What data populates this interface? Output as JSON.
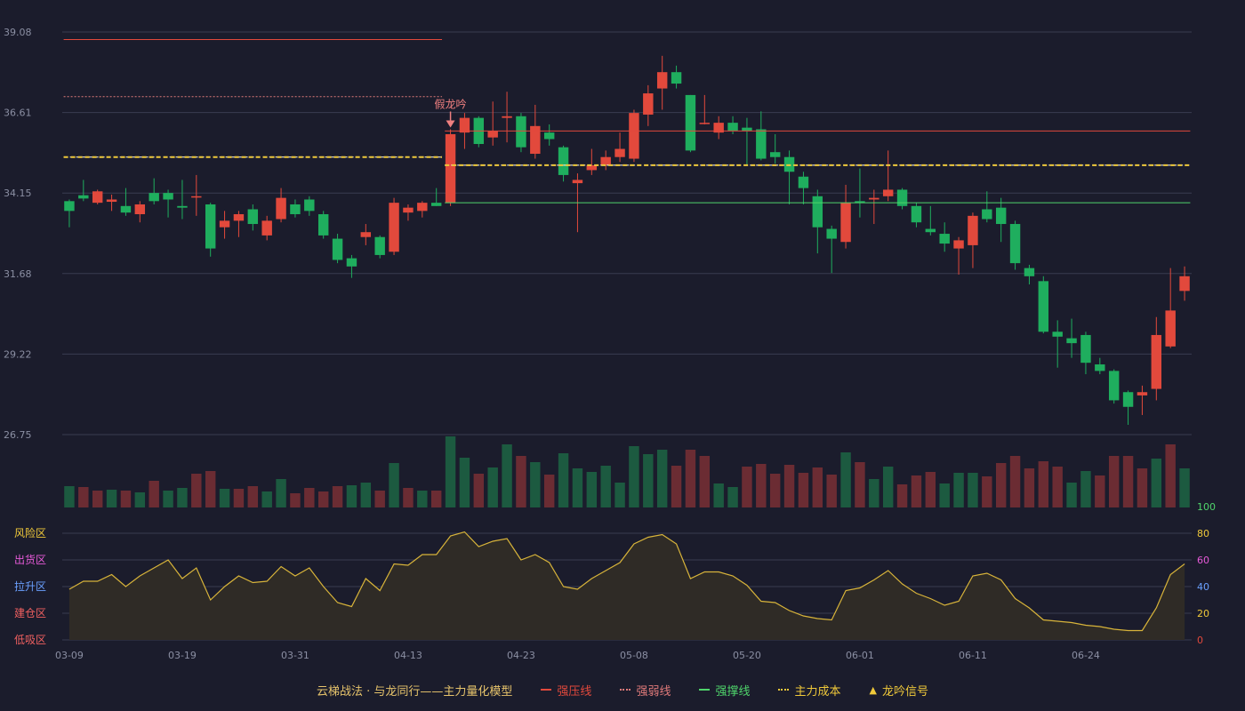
{
  "colors": {
    "background": "#1b1c2c",
    "grid": "#3a3c50",
    "axis_text": "#8b8fa3",
    "up": "#e2493c",
    "down": "#1fae5e",
    "vol_up": "#6b2c33",
    "vol_down": "#1c5a40",
    "pressure": "#e2493c",
    "weak": "#e07a7a",
    "support": "#4fd46b",
    "cost": "#f0c93a",
    "oscillator": "#d8b43a",
    "osc_fill": "#2f2b26"
  },
  "legend": {
    "title": "云梯战法 · 与龙同行——主力量化模型",
    "items": [
      {
        "label": "强压线",
        "color": "#e2493c",
        "style": "solid"
      },
      {
        "label": "强弱线",
        "color": "#e07a7a",
        "style": "dotted"
      },
      {
        "label": "强撑线",
        "color": "#4fd46b",
        "style": "solid"
      },
      {
        "label": "主力成本",
        "color": "#f0c93a",
        "style": "dotted"
      },
      {
        "label": "龙吟信号",
        "color": "#f0c93a",
        "style": "triangle"
      }
    ]
  },
  "chart_data": {
    "type": "candlestick",
    "price_axis": {
      "ticks": [
        "39.08",
        "36.61",
        "34.15",
        "31.68",
        "29.22",
        "26.75"
      ],
      "range": [
        26.75,
        39.08
      ]
    },
    "x_tick_labels": [
      {
        "index": 0,
        "label": "03-09"
      },
      {
        "index": 8,
        "label": "03-19"
      },
      {
        "index": 16,
        "label": "03-31"
      },
      {
        "index": 24,
        "label": "04-13"
      },
      {
        "index": 32,
        "label": "04-23"
      },
      {
        "index": 40,
        "label": "05-08"
      },
      {
        "index": 48,
        "label": "05-20"
      },
      {
        "index": 56,
        "label": "06-01"
      },
      {
        "index": 64,
        "label": "06-11"
      },
      {
        "index": 72,
        "label": "06-24"
      }
    ],
    "candles": [
      [
        33.9,
        33.6,
        33.95,
        33.1
      ],
      [
        34.08,
        33.98,
        34.55,
        33.9
      ],
      [
        33.85,
        34.2,
        34.25,
        33.8
      ],
      [
        33.88,
        33.95,
        34.1,
        33.6
      ],
      [
        33.75,
        33.55,
        34.3,
        33.45
      ],
      [
        33.5,
        33.8,
        33.9,
        33.25
      ],
      [
        34.15,
        33.9,
        34.6,
        33.8
      ],
      [
        34.15,
        33.95,
        34.25,
        33.4
      ],
      [
        33.75,
        33.7,
        34.55,
        33.35
      ],
      [
        34.02,
        34.05,
        34.7,
        33.45
      ],
      [
        33.8,
        32.45,
        33.85,
        32.2
      ],
      [
        33.1,
        33.3,
        33.6,
        32.75
      ],
      [
        33.3,
        33.5,
        33.6,
        32.8
      ],
      [
        33.65,
        33.2,
        33.8,
        33.0
      ],
      [
        32.85,
        33.3,
        33.45,
        32.7
      ],
      [
        33.35,
        34.0,
        34.3,
        33.25
      ],
      [
        33.8,
        33.5,
        33.95,
        33.4
      ],
      [
        33.95,
        33.6,
        34.05,
        33.45
      ],
      [
        33.5,
        32.85,
        33.6,
        32.75
      ],
      [
        32.75,
        32.1,
        32.9,
        32.0
      ],
      [
        32.15,
        31.9,
        32.25,
        31.55
      ],
      [
        32.8,
        32.95,
        33.2,
        32.55
      ],
      [
        32.8,
        32.25,
        32.85,
        32.15
      ],
      [
        32.35,
        33.85,
        34.0,
        32.25
      ],
      [
        33.55,
        33.7,
        33.8,
        33.3
      ],
      [
        33.6,
        33.85,
        33.9,
        33.4
      ],
      [
        33.85,
        33.75,
        34.3,
        33.75
      ],
      [
        33.85,
        35.95,
        36.1,
        33.75
      ],
      [
        36.0,
        36.45,
        36.6,
        35.5
      ],
      [
        36.45,
        35.65,
        36.5,
        35.55
      ],
      [
        35.85,
        36.05,
        36.95,
        35.6
      ],
      [
        36.45,
        36.5,
        37.25,
        35.7
      ],
      [
        36.5,
        35.55,
        36.6,
        35.4
      ],
      [
        35.35,
        36.2,
        36.85,
        35.2
      ],
      [
        36.0,
        35.8,
        36.25,
        35.6
      ],
      [
        35.55,
        34.7,
        35.6,
        34.5
      ],
      [
        34.45,
        34.55,
        34.75,
        32.95
      ],
      [
        34.85,
        35.0,
        35.5,
        34.7
      ],
      [
        35.0,
        35.25,
        35.45,
        34.85
      ],
      [
        35.25,
        35.5,
        36.0,
        35.1
      ],
      [
        35.2,
        36.6,
        36.7,
        35.1
      ],
      [
        36.55,
        37.2,
        37.45,
        36.2
      ],
      [
        37.35,
        37.85,
        38.35,
        36.7
      ],
      [
        37.85,
        37.5,
        38.05,
        37.35
      ],
      [
        37.15,
        35.45,
        37.15,
        35.4
      ],
      [
        36.3,
        36.3,
        37.15,
        36.25
      ],
      [
        36.0,
        36.3,
        36.5,
        35.8
      ],
      [
        36.3,
        36.05,
        36.5,
        35.95
      ],
      [
        36.15,
        36.05,
        36.45,
        35.0
      ],
      [
        36.1,
        35.2,
        36.65,
        35.15
      ],
      [
        35.4,
        35.25,
        35.95,
        35.05
      ],
      [
        35.25,
        34.8,
        35.45,
        33.8
      ],
      [
        34.65,
        34.3,
        34.8,
        33.8
      ],
      [
        34.05,
        33.1,
        34.25,
        32.3
      ],
      [
        33.05,
        32.75,
        33.15,
        31.7
      ],
      [
        32.65,
        33.85,
        34.4,
        32.45
      ],
      [
        33.9,
        33.85,
        34.9,
        33.4
      ],
      [
        33.95,
        34.0,
        34.25,
        33.2
      ],
      [
        34.05,
        34.25,
        35.45,
        33.9
      ],
      [
        34.25,
        33.75,
        34.3,
        33.65
      ],
      [
        33.75,
        33.25,
        33.85,
        33.1
      ],
      [
        33.05,
        32.95,
        33.75,
        32.85
      ],
      [
        32.9,
        32.6,
        33.25,
        32.35
      ],
      [
        32.45,
        32.7,
        32.8,
        31.65
      ],
      [
        32.55,
        33.45,
        33.55,
        31.85
      ],
      [
        33.65,
        33.35,
        34.2,
        33.25
      ],
      [
        33.7,
        33.2,
        34.0,
        32.65
      ],
      [
        33.2,
        32.0,
        33.3,
        31.8
      ],
      [
        31.85,
        31.6,
        31.95,
        31.35
      ],
      [
        31.45,
        29.9,
        31.6,
        29.85
      ],
      [
        29.9,
        29.75,
        30.25,
        28.8
      ],
      [
        29.7,
        29.55,
        30.3,
        29.1
      ],
      [
        29.8,
        28.95,
        29.9,
        28.6
      ],
      [
        28.9,
        28.7,
        29.1,
        28.6
      ],
      [
        28.7,
        27.8,
        28.75,
        27.7
      ],
      [
        28.05,
        27.6,
        28.1,
        27.05
      ],
      [
        27.95,
        28.05,
        28.25,
        27.35
      ],
      [
        28.15,
        29.8,
        30.35,
        27.8
      ],
      [
        29.45,
        30.55,
        31.85,
        29.4
      ],
      [
        31.15,
        31.6,
        31.9,
        30.85
      ]
    ],
    "volume_direction": [
      "down",
      "up",
      "up",
      "down",
      "up",
      "down",
      "up",
      "down",
      "down",
      "up",
      "up",
      "down",
      "up",
      "up",
      "down",
      "down",
      "up",
      "up",
      "up",
      "up",
      "down",
      "down",
      "up",
      "down",
      "up",
      "down",
      "up",
      "down",
      "down",
      "up",
      "down",
      "down",
      "up",
      "down",
      "up",
      "down",
      "down",
      "down",
      "down",
      "down",
      "down",
      "down",
      "down",
      "up",
      "up",
      "up",
      "down",
      "down",
      "up",
      "up",
      "up",
      "up",
      "up",
      "up",
      "up",
      "down",
      "up",
      "down",
      "down",
      "up",
      "up",
      "up",
      "down",
      "down",
      "down",
      "up",
      "up",
      "up",
      "up",
      "up",
      "up",
      "down",
      "down",
      "up",
      "up",
      "up",
      "up",
      "down",
      "up",
      "down",
      "down",
      "down"
    ],
    "volume_heights": [
      24,
      23,
      19,
      20,
      19,
      17,
      30,
      19,
      22,
      38,
      41,
      21,
      21,
      24,
      18,
      32,
      16,
      22,
      18,
      24,
      25,
      28,
      19,
      50,
      22,
      19,
      19,
      80,
      56,
      38,
      45,
      71,
      58,
      51,
      37,
      61,
      44,
      40,
      47,
      28,
      69,
      60,
      65,
      47,
      65,
      58,
      27,
      23,
      46,
      49,
      38,
      48,
      39,
      45,
      37,
      62,
      51,
      32,
      46,
      26,
      36,
      40,
      27,
      39,
      39,
      35,
      50,
      58,
      44,
      52,
      46,
      28,
      41,
      36,
      58,
      58,
      44,
      55,
      71,
      44
    ],
    "oscillator": {
      "axis_ticks": [
        "100",
        "80",
        "60",
        "40",
        "20",
        "0"
      ],
      "zones": [
        "风险区",
        "出货区",
        "拉升区",
        "建仓区",
        "低吸区"
      ],
      "values": [
        38,
        44,
        44,
        49,
        40,
        48,
        54,
        60,
        46,
        54,
        30,
        40,
        48,
        43,
        44,
        55,
        48,
        54,
        40,
        28,
        25,
        46,
        37,
        57,
        56,
        64,
        64,
        78,
        81,
        70,
        74,
        76,
        60,
        64,
        58,
        40,
        38,
        46,
        52,
        58,
        72,
        77,
        79,
        72,
        46,
        51,
        51,
        48,
        41,
        29,
        28,
        22,
        18,
        16,
        15,
        37,
        39,
        45,
        52,
        42,
        35,
        31,
        26,
        29,
        48,
        50,
        45,
        31,
        24,
        15,
        14,
        13,
        11,
        10,
        8,
        7,
        7,
        24,
        49,
        57
      ]
    },
    "lines": {
      "strong_pressure": [
        {
          "y": 38.85,
          "from": 0,
          "to": 26
        },
        {
          "y": 36.05,
          "from": 27,
          "to": 79
        }
      ],
      "strong_weak": [
        {
          "y": 37.1,
          "from": 0,
          "to": 26
        }
      ],
      "strong_support": [
        {
          "y": 33.85,
          "from": 27,
          "to": 79
        }
      ],
      "main_cost": [
        {
          "y": 35.25,
          "from": 0,
          "to": 26
        },
        {
          "y": 35.0,
          "from": 27,
          "to": 79
        }
      ]
    },
    "signal": {
      "label": "假龙吟",
      "index": 27
    }
  }
}
